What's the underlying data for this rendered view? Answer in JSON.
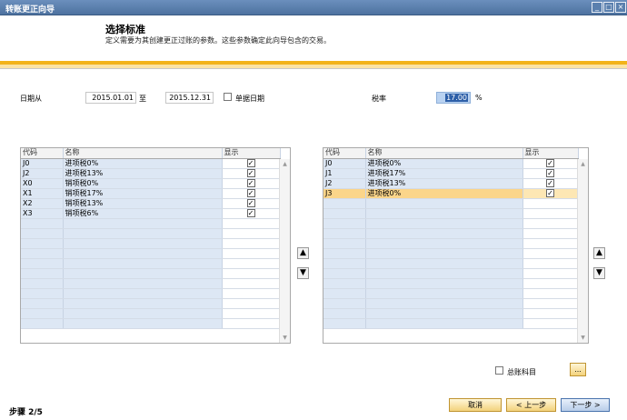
{
  "window": {
    "title": "转账更正向导"
  },
  "header": {
    "title": "选择标准",
    "description": "定义需要为其创建更正过账的参数。这些参数确定此向导包含的交易。"
  },
  "form": {
    "date_from_label": "日期从",
    "date_from": "2015.01.01",
    "date_to_label": "至",
    "date_to": "2015.12.31",
    "single_date_label": "单据日期",
    "tax_rate_label": "税率",
    "tax_rate": "17.00",
    "tax_rate_unit": "%"
  },
  "left_grid": {
    "headers": [
      "代码",
      "名称",
      "显示"
    ],
    "rows": [
      {
        "code": "J0",
        "name": "进项税0%",
        "show": "✓"
      },
      {
        "code": "J2",
        "name": "进项税13%",
        "show": "✓"
      },
      {
        "code": "X0",
        "name": "销项税0%",
        "show": "✓"
      },
      {
        "code": "X1",
        "name": "销项税17%",
        "show": "✓"
      },
      {
        "code": "X2",
        "name": "销项税13%",
        "show": "✓"
      },
      {
        "code": "X3",
        "name": "销项税6%",
        "show": "✓"
      }
    ]
  },
  "right_grid": {
    "headers": [
      "代码",
      "名称",
      "显示"
    ],
    "rows": [
      {
        "code": "J0",
        "name": "进项税0%",
        "show": "✓"
      },
      {
        "code": "J1",
        "name": "进项税17%",
        "show": "✓"
      },
      {
        "code": "J2",
        "name": "进项税13%",
        "show": "✓"
      },
      {
        "code": "J3",
        "name": "进项税0%",
        "show": "✓"
      }
    ]
  },
  "icons": {
    "move_up": "▲",
    "move_down": "▼"
  },
  "gl_account_label": "总账科目",
  "browse_label": "...",
  "footer": {
    "step": "步骤 2/5",
    "cancel": "取消",
    "back": "< 上一步",
    "next": "下一步 >"
  }
}
